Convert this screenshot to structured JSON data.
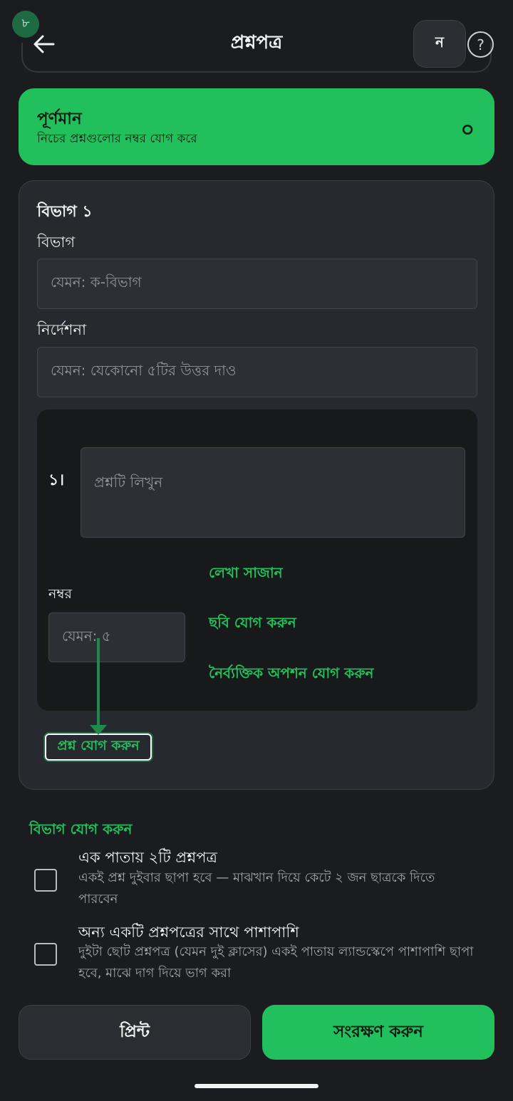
{
  "header": {
    "step_badge": "৮",
    "title": "প্রশ্নপত্র",
    "font_button_label": "ন",
    "help_label": "?"
  },
  "total": {
    "title": "পূর্ণমান",
    "subtitle": "নিচের প্রশ্নগুলোর নম্বর যোগ করে",
    "value": "০"
  },
  "section": {
    "title": "বিভাগ ১",
    "name_label": "বিভাগ",
    "name_placeholder": "যেমন: ক-বিভাগ",
    "instruction_label": "নির্দেশনা",
    "instruction_placeholder": "যেমন: যেকোনো ৫টির উত্তর দাও",
    "question": {
      "number": "১।",
      "placeholder": "প্রশ্নটি লিখুন",
      "format_text_link": "লেখা সাজান",
      "marks_label": "নম্বর",
      "marks_placeholder": "যেমন: ৫",
      "add_image_link": "ছবি যোগ করুন",
      "add_mcq_link": "নৈর্ব্যক্তিক অপশন যোগ করুন"
    },
    "add_question_label": "প্রশ্ন যোগ করুন"
  },
  "add_section_label": "বিভাগ যোগ করুন",
  "options": [
    {
      "title": "এক পাতায় ২টি প্রশ্নপত্র",
      "description": "একই প্রশ্ন দুইবার ছাপা হবে — মাঝখান দিয়ে কেটে ২ জন ছাত্রকে দিতে পারবেন",
      "checked": false
    },
    {
      "title": "অন্য একটি প্রশ্নপত্রের সাথে পাশাপাশি",
      "description": "দুইটা ছোট প্রশ্নপত্র (যেমন দুই ক্লাসের) একই পাতায় ল্যান্ডস্কেপে পাশাপাশি ছাপা হবে, মাঝে দাগ দিয়ে ভাগ করা",
      "checked": false
    }
  ],
  "footer": {
    "print_label": "প্রিন্ট",
    "save_label": "সংরক্ষণ করুন"
  },
  "colors": {
    "accent": "#22c05d",
    "background": "#1a1c1f",
    "card": "#26292d"
  }
}
